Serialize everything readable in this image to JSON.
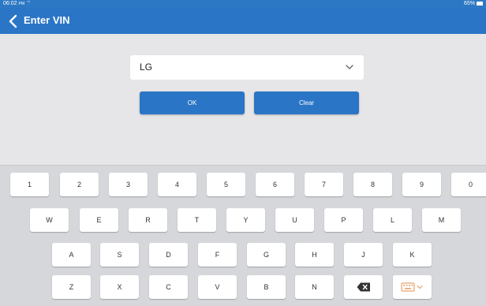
{
  "status": {
    "time": "06:02",
    "ampm": "PM",
    "battery": "65%"
  },
  "header": {
    "title": "Enter VIN"
  },
  "vin": {
    "value": "LG"
  },
  "buttons": {
    "ok": "OK",
    "clear": "Clear"
  },
  "keyboard": {
    "row1": [
      "1",
      "2",
      "3",
      "4",
      "5",
      "6",
      "7",
      "8",
      "9",
      "0"
    ],
    "row2": [
      "W",
      "E",
      "R",
      "T",
      "Y",
      "U",
      "P",
      "L",
      "M"
    ],
    "row3": [
      "A",
      "S",
      "D",
      "F",
      "G",
      "H",
      "J",
      "K"
    ],
    "row4": [
      "Z",
      "X",
      "C",
      "V",
      "B",
      "N"
    ],
    "icons": {
      "backspace": "backspace-icon",
      "keyboard": "keyboard-icon"
    }
  },
  "colors": {
    "primary": "#2a75c6",
    "background": "#e6e6e8",
    "keyboard_bg": "#d6d7db",
    "keyboard_icon": "#e8a26a"
  }
}
